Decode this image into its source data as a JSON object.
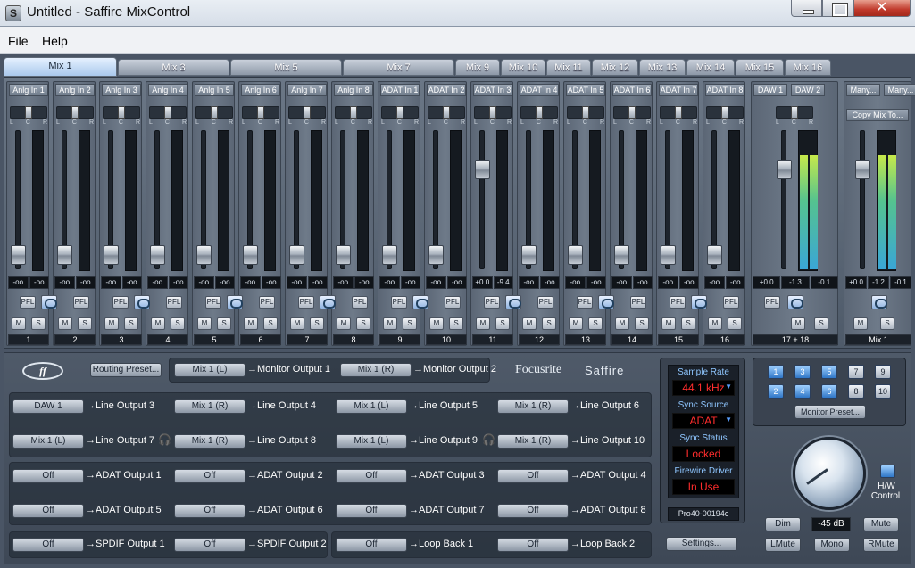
{
  "window": {
    "title": "Untitled - Saffire MixControl",
    "minimize": "minimize",
    "maximize": "maximize",
    "close": "✕"
  },
  "menu": [
    "File",
    "Help"
  ],
  "tabs": [
    "Mix 1",
    "Mix 3",
    "Mix 5",
    "Mix 7",
    "Mix 9",
    "Mix 10",
    "Mix 11",
    "Mix 12",
    "Mix 13",
    "Mix 14",
    "Mix 15",
    "Mix 16"
  ],
  "pan_labels": [
    "L",
    "C",
    "R"
  ],
  "strips": [
    {
      "name": "Anlg In 1",
      "l": "-oo",
      "r": "-oo",
      "num": "1",
      "level": 0.14
    },
    {
      "name": "Anlg In 2",
      "l": "-oo",
      "r": "-oo",
      "num": "2",
      "level": 0.14
    },
    {
      "name": "Anlg In 3",
      "l": "-oo",
      "r": "-oo",
      "num": "3",
      "level": 0.14
    },
    {
      "name": "Anlg In 4",
      "l": "-oo",
      "r": "-oo",
      "num": "4",
      "level": 0.14
    },
    {
      "name": "Anlg In 5",
      "l": "-oo",
      "r": "-oo",
      "num": "5",
      "level": 0.14
    },
    {
      "name": "Anlg In 6",
      "l": "-oo",
      "r": "-oo",
      "num": "6",
      "level": 0.14
    },
    {
      "name": "Anlg In 7",
      "l": "-oo",
      "r": "-oo",
      "num": "7",
      "level": 0.14
    },
    {
      "name": "Anlg In 8",
      "l": "-oo",
      "r": "-oo",
      "num": "8",
      "level": 0.14
    },
    {
      "name": "ADAT In 1",
      "l": "-oo",
      "r": "-oo",
      "num": "9",
      "level": 0.14
    },
    {
      "name": "ADAT In 2",
      "l": "-oo",
      "r": "-oo",
      "num": "10",
      "level": 0.14
    },
    {
      "name": "ADAT In 3",
      "l": "+0.0",
      "r": "-9.4",
      "num": "11",
      "level": 0.78
    },
    {
      "name": "ADAT In 4",
      "l": "-oo",
      "r": "-oo",
      "num": "12",
      "level": 0.14
    },
    {
      "name": "ADAT In 5",
      "l": "-oo",
      "r": "-oo",
      "num": "13",
      "level": 0.14
    },
    {
      "name": "ADAT In 6",
      "l": "-oo",
      "r": "-oo",
      "num": "14",
      "level": 0.14
    },
    {
      "name": "ADAT In 7",
      "l": "-oo",
      "r": "-oo",
      "num": "15",
      "level": 0.14
    },
    {
      "name": "ADAT In 8",
      "l": "-oo",
      "r": "-oo",
      "num": "16",
      "level": 0.14
    }
  ],
  "daw": {
    "names": [
      "DAW 1",
      "DAW 2"
    ],
    "fader": "+0.0",
    "l": "-1.3",
    "r": "-0.1",
    "num": "17 + 18",
    "level": 0.78
  },
  "mixout": {
    "names": [
      "Many...",
      "Many..."
    ],
    "copy": "Copy Mix To...",
    "fader": "+0.0",
    "l": "-1.2",
    "r": "-0.1",
    "num": "Mix 1",
    "level": 0.78
  },
  "buttons": {
    "pfl": "PFL",
    "mute": "M",
    "solo": "S"
  },
  "routing": {
    "preset": "Routing Preset...",
    "brand1": "Focusrite",
    "brand2": "Saffire",
    "monitor": [
      {
        "src": "Mix 1 (L)",
        "dst": "→Monitor Output 1"
      },
      {
        "src": "Mix 1 (R)",
        "dst": "→Monitor Output 2"
      }
    ],
    "line": [
      {
        "src": "DAW 1",
        "dst": "→Line Output 3"
      },
      {
        "src": "Mix 1 (R)",
        "dst": "→Line Output 4"
      },
      {
        "src": "Mix 1 (L)",
        "dst": "→Line Output 5"
      },
      {
        "src": "Mix 1 (R)",
        "dst": "→Line Output 6"
      },
      {
        "src": "Mix 1 (L)",
        "dst": "→Line Output 7"
      },
      {
        "src": "Mix 1 (R)",
        "dst": "→Line Output 8"
      },
      {
        "src": "Mix 1 (L)",
        "dst": "→Line Output 9"
      },
      {
        "src": "Mix 1 (R)",
        "dst": "→Line Output 10"
      }
    ],
    "adat": [
      {
        "src": "Off",
        "dst": "→ADAT Output 1"
      },
      {
        "src": "Off",
        "dst": "→ADAT Output 2"
      },
      {
        "src": "Off",
        "dst": "→ADAT Output 3"
      },
      {
        "src": "Off",
        "dst": "→ADAT Output 4"
      },
      {
        "src": "Off",
        "dst": "→ADAT Output 5"
      },
      {
        "src": "Off",
        "dst": "→ADAT Output 6"
      },
      {
        "src": "Off",
        "dst": "→ADAT Output 7"
      },
      {
        "src": "Off",
        "dst": "→ADAT Output 8"
      }
    ],
    "spdif": [
      {
        "src": "Off",
        "dst": "→SPDIF Output 1"
      },
      {
        "src": "Off",
        "dst": "→SPDIF Output 2"
      }
    ],
    "loop": [
      {
        "src": "Off",
        "dst": "→Loop Back 1"
      },
      {
        "src": "Off",
        "dst": "→Loop Back 2"
      }
    ]
  },
  "status": {
    "sample_rate_label": "Sample Rate",
    "sample_rate": "44.1 kHz",
    "sync_source_label": "Sync Source",
    "sync_source": "ADAT",
    "sync_status_label": "Sync Status",
    "sync_status": "Locked",
    "firewire_label": "Firewire Driver",
    "firewire": "In Use",
    "device": "Pro40-00194c",
    "settings": "Settings..."
  },
  "monitor": {
    "nums": [
      "1",
      "3",
      "5",
      "7",
      "9",
      "2",
      "4",
      "6",
      "8",
      "10"
    ],
    "preset": "Monitor Preset...",
    "hw1": "H/W",
    "hw2": "Control",
    "dim": "Dim",
    "level": "-45 dB",
    "mute": "Mute",
    "lmute": "LMute",
    "mono": "Mono",
    "rmute": "RMute"
  }
}
